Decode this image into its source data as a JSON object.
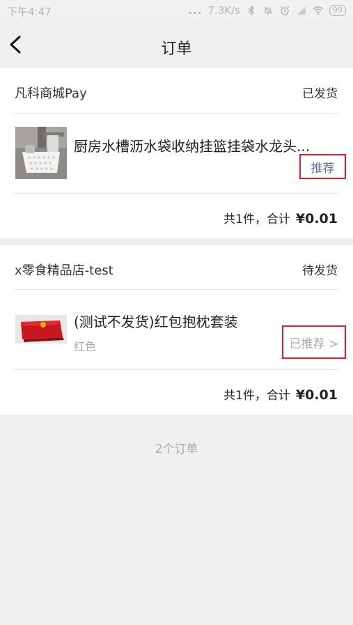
{
  "status_bar": {
    "time": "下午4:47",
    "dots": "...",
    "speed": "7.3K/s",
    "battery": "99"
  },
  "nav": {
    "title": "订单"
  },
  "orders": [
    {
      "shop": "凡科商城Pay",
      "status": "已发货",
      "product_name": "厨房水槽沥水袋收纳挂篮挂袋水龙头...",
      "spec": "",
      "recommend_label": "推荐",
      "total_label": "共1件，合计",
      "total_amount": "¥0.01"
    },
    {
      "shop": "x零食精品店-test",
      "status": "待发货",
      "product_name": "(测试不发货)红包抱枕套装",
      "spec": "红色",
      "recommend_label": "已推荐 >",
      "total_label": "共1件，合计",
      "total_amount": "¥0.01"
    }
  ],
  "footer": {
    "count": "2个订单"
  },
  "colors": {
    "highlight": "#d9202b",
    "recommend_text": "#5a6e9c",
    "recommended_text": "#aaaaaa"
  }
}
